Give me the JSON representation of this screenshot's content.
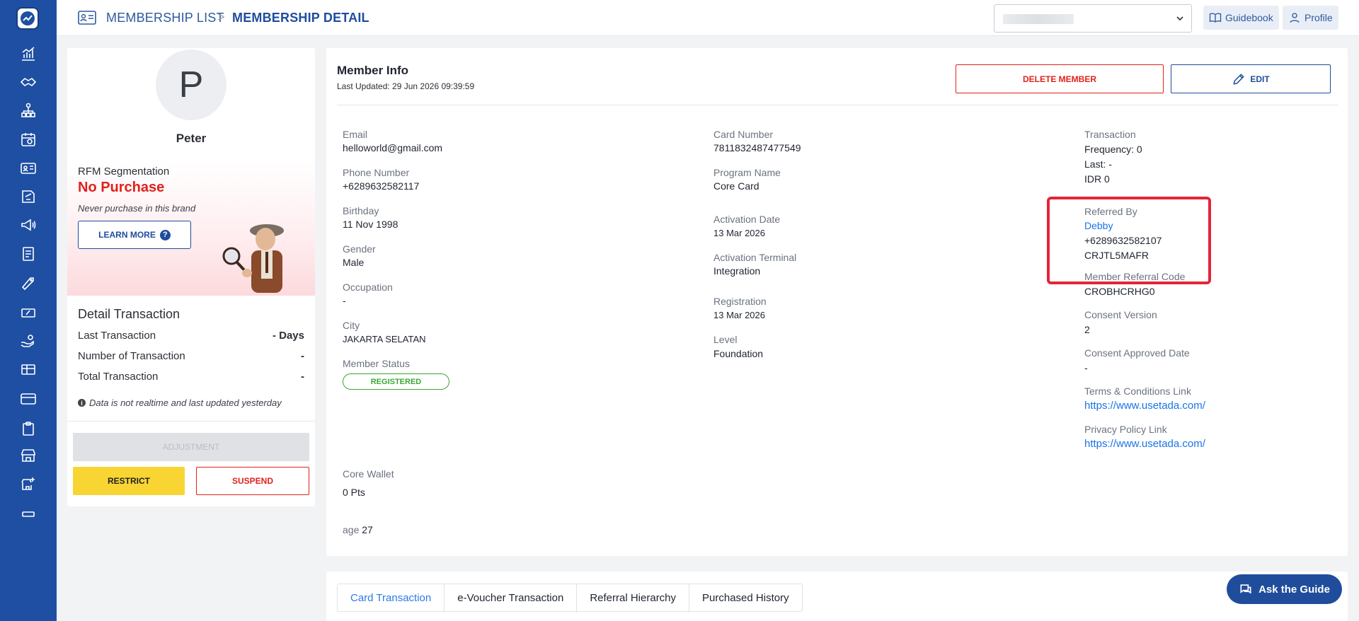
{
  "breadcrumb": {
    "list": "MEMBERSHIP LIST",
    "separator": ">",
    "current": "MEMBERSHIP DETAIL"
  },
  "topbar": {
    "guidebook": "Guidebook",
    "profile": "Profile"
  },
  "sidebar": {
    "icons": [
      "analytics-icon",
      "handshake-icon",
      "hierarchy-icon",
      "calendar-icon",
      "membership-card-icon",
      "voucher-icon",
      "megaphone-icon",
      "document-icon",
      "tag-icon",
      "coupon-icon",
      "hand-coin-icon",
      "gift-card-icon",
      "credit-card-icon",
      "clipboard-icon",
      "store-icon",
      "add-store-icon",
      "more-icon"
    ]
  },
  "profile": {
    "initial": "P",
    "name": "Peter",
    "rfm_label": "RFM Segmentation",
    "rfm_value": "No Purchase",
    "rfm_desc": "Never purchase in this brand",
    "learn_more": "LEARN MORE",
    "learn_more_icon": "?"
  },
  "detail_transaction": {
    "title": "Detail Transaction",
    "rows": [
      {
        "label": "Last Transaction",
        "value": "- Days"
      },
      {
        "label": "Number of Transaction",
        "value": "-"
      },
      {
        "label": "Total Transaction",
        "value": "-"
      }
    ],
    "note": "Data is not realtime and last updated yesterday"
  },
  "actions": {
    "adjustment": "ADJUSTMENT",
    "restrict": "RESTRICT",
    "suspend": "SUSPEND"
  },
  "member_info": {
    "title": "Member Info",
    "last_updated": "Last Updated: 29 Jun 2026 09:39:59",
    "delete": "DELETE MEMBER",
    "edit": "EDIT",
    "col1": {
      "email_label": "Email",
      "email": "helloworld@gmail.com",
      "phone_label": "Phone Number",
      "phone": "+6289632582117",
      "birthday_label": "Birthday",
      "birthday": "11 Nov 1998",
      "gender_label": "Gender",
      "gender": "Male",
      "occupation_label": "Occupation",
      "occupation": "-",
      "city_label": "City",
      "city": "JAKARTA SELATAN",
      "status_label": "Member Status",
      "status": "REGISTERED",
      "wallet_label": "Core Wallet",
      "wallet": "0 Pts",
      "age_label": "age",
      "age": "27"
    },
    "col2": {
      "card_label": "Card Number",
      "card": "7811832487477549",
      "program_label": "Program Name",
      "program": "Core Card",
      "activation_label": "Activation Date",
      "activation": "13 Mar 2026",
      "terminal_label": "Activation Terminal",
      "terminal": "Integration",
      "registration_label": "Registration",
      "registration": "13 Mar 2026",
      "level_label": "Level",
      "level": "Foundation"
    },
    "col3": {
      "transaction_label": "Transaction",
      "frequency": "Frequency: 0",
      "last": "Last: -",
      "idr": "IDR 0",
      "referred_label": "Referred By",
      "referred_name": "Debby",
      "referred_phone": "+6289632582107",
      "referred_code": "CRJTL5MAFR",
      "member_ref_label": "Member Referral Code",
      "member_ref": "CROBHCRHG0",
      "consent_version_label": "Consent Version",
      "consent_version": "2",
      "consent_date_label": "Consent Approved Date",
      "consent_date": "-",
      "terms_label": "Terms & Conditions Link",
      "terms": "https://www.usetada.com/",
      "privacy_label": "Privacy Policy Link",
      "privacy": "https://www.usetada.com/"
    }
  },
  "tabs": [
    "Card Transaction",
    "e-Voucher Transaction",
    "Referral Hierarchy",
    "Purchased History"
  ],
  "ask_guide": "Ask the Guide",
  "colors": {
    "sidebar": "#1e4fa3",
    "accent": "#1f4d9c",
    "danger": "#e0221c",
    "success": "#3aa831",
    "highlight": "#e4243a",
    "link": "#1a73e8"
  }
}
